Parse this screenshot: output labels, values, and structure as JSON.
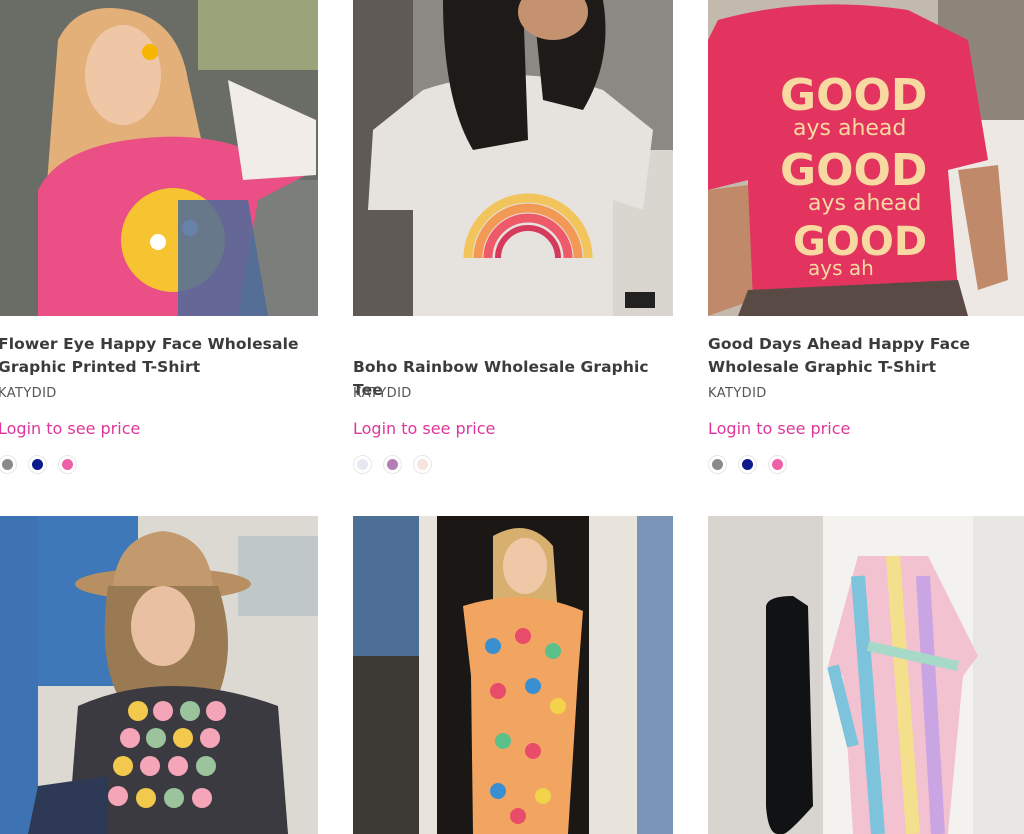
{
  "products": [
    {
      "title_line1": "Flower Eye Happy Face Wholesale",
      "title_line2": "Graphic Printed T-Shirt",
      "brand": "KATYDID",
      "price_cta": "Login to see price",
      "swatches": [
        "#8a8a8a",
        "#0d1a8c",
        "#f060a8"
      ]
    },
    {
      "title_line1": "Boho Rainbow Wholesale Graphic Tee",
      "title_line2": "",
      "brand": "KATYDID",
      "price_cta": "Login to see price",
      "swatches": [
        "#e6e8f0",
        "#b47db8",
        "#f7e3dd"
      ]
    },
    {
      "title_line1": "Good Days Ahead Happy Face",
      "title_line2": "Wholesale Graphic T-Shirt",
      "brand": "KATYDID",
      "price_cta": "Login to see price",
      "swatches": [
        "#8a8a8a",
        "#0d1a8c",
        "#f060a8"
      ]
    }
  ],
  "colors": {
    "accent": "#e0359b",
    "title": "#3b3b3b"
  }
}
